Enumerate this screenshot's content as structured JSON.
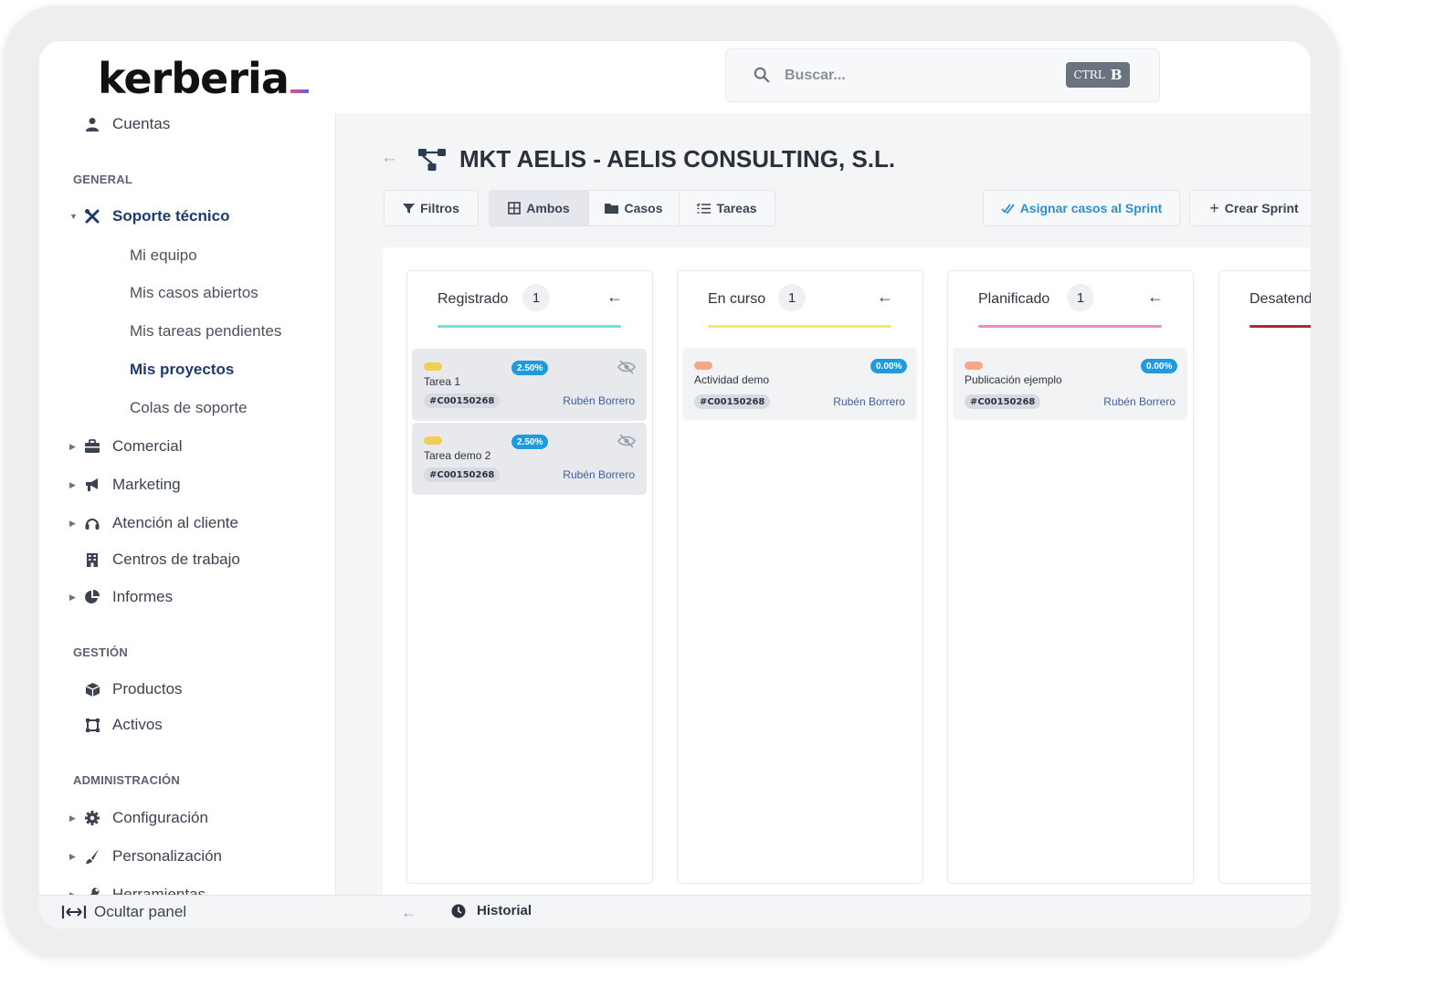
{
  "header": {
    "logo_text": "kerberia",
    "search": {
      "placeholder": "Buscar...",
      "kbd_ctrl": "CTRL",
      "kbd_key": "B"
    }
  },
  "sidebar": {
    "top_item": "Cuentas",
    "section_general": "GENERAL",
    "soporte": {
      "label": "Soporte técnico",
      "children": [
        "Mi equipo",
        "Mis casos abiertos",
        "Mis tareas pendientes",
        "Mis proyectos",
        "Colas de soporte"
      ],
      "active_child": "Mis proyectos"
    },
    "items_general": [
      {
        "label": "Comercial",
        "icon": "briefcase-icon",
        "expandable": true
      },
      {
        "label": "Marketing",
        "icon": "megaphone-icon",
        "expandable": true
      },
      {
        "label": "Atención al cliente",
        "icon": "headset-icon",
        "expandable": true
      },
      {
        "label": "Centros de trabajo",
        "icon": "building-icon",
        "expandable": false
      },
      {
        "label": "Informes",
        "icon": "pie-chart-icon",
        "expandable": true
      }
    ],
    "section_gestion": "GESTIÓN",
    "items_gestion": [
      {
        "label": "Productos",
        "icon": "box-icon"
      },
      {
        "label": "Activos",
        "icon": "asset-icon"
      }
    ],
    "section_admin": "ADMINISTRACIÓN",
    "items_admin": [
      {
        "label": "Configuración",
        "icon": "gear-icon"
      },
      {
        "label": "Personalización",
        "icon": "brush-icon"
      },
      {
        "label": "Herramientas",
        "icon": "wrench-icon"
      }
    ],
    "hide_panel": "Ocultar panel"
  },
  "main": {
    "title": "MKT AELIS - AELIS CONSULTING, S.L.",
    "toolbar": {
      "filters": "Filtros",
      "view_both": "Ambos",
      "view_cases": "Casos",
      "view_tasks": "Tareas",
      "active_view": "Ambos",
      "assign": "Asignar casos al Sprint",
      "create": "Crear Sprint"
    },
    "columns": [
      {
        "title": "Registrado",
        "count": "1",
        "color": "#6fe0e0",
        "cards": [
          {
            "title": "Tarea 1",
            "percent": "2.50%",
            "code": "#C00150268",
            "owner": "Rubén Borrero",
            "tag_color": "#f1cf55",
            "hidden_icon": true
          },
          {
            "title": "Tarea demo 2",
            "percent": "2.50%",
            "code": "#C00150268",
            "owner": "Rubén Borrero",
            "tag_color": "#f1cf55",
            "hidden_icon": true
          }
        ]
      },
      {
        "title": "En curso",
        "count": "1",
        "color": "#f4ea6a",
        "cards": [
          {
            "title": "Actividad demo",
            "percent": "0.00%",
            "code": "#C00150268",
            "owner": "Rubén Borrero",
            "tag_color": "#f5a98a",
            "hidden_icon": false
          }
        ]
      },
      {
        "title": "Planificado",
        "count": "1",
        "color": "#f08bc2",
        "cards": [
          {
            "title": "Publicación ejemplo",
            "percent": "0.00%",
            "code": "#C00150268",
            "owner": "Rubén Borrero",
            "tag_color": "#f5a98a",
            "hidden_icon": false
          }
        ]
      },
      {
        "title": "Desatend",
        "count": "",
        "color": "#a82c2c",
        "cards": []
      }
    ]
  },
  "footer": {
    "history": "Historial"
  }
}
